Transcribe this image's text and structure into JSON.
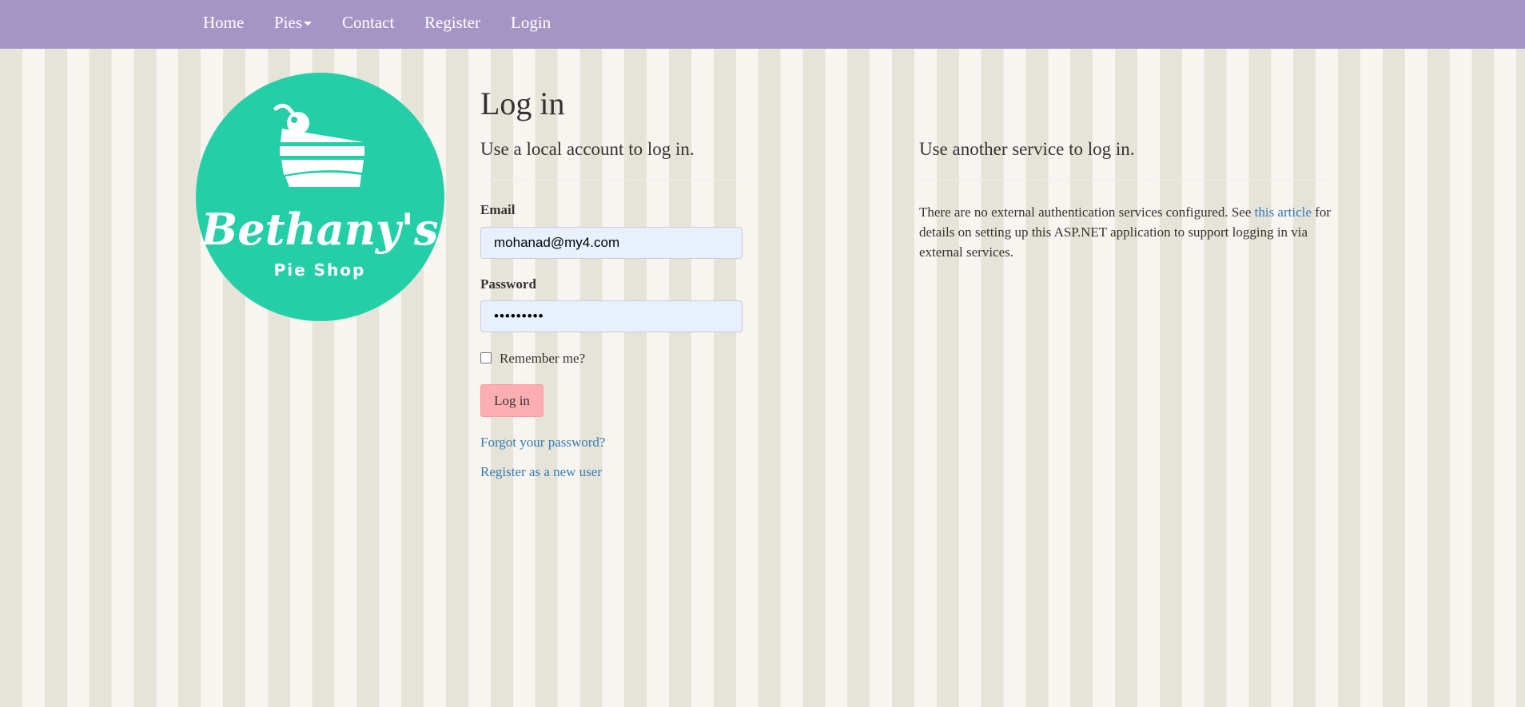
{
  "nav": {
    "home": "Home",
    "pies": "Pies",
    "contact": "Contact",
    "register": "Register",
    "login": "Login"
  },
  "logo": {
    "brand": "Bethany's",
    "tagline": "Pie Shop",
    "color": "#24cfa8",
    "icon": "pie-slice-icon"
  },
  "login": {
    "title": "Log in",
    "local_heading": "Use a local account to log in.",
    "email_label": "Email",
    "email_value": "mohanad@my4.com",
    "password_label": "Password",
    "password_value": "password1",
    "remember_label": "Remember me?",
    "remember_checked": false,
    "submit_label": "Log in",
    "forgot_link": "Forgot your password?",
    "register_link": "Register as a new user"
  },
  "external": {
    "heading": "Use another service to log in.",
    "text_before": "There are no external authentication services configured. See ",
    "link_text": "this article",
    "text_after": " for details on setting up this ASP.NET application to support logging in via external services."
  },
  "colors": {
    "navbar": "#a595c4",
    "link": "#337ab7",
    "button": "#fcaeb2",
    "stripe_dark": "#e6e4d8",
    "stripe_light": "#f8f5f1"
  }
}
